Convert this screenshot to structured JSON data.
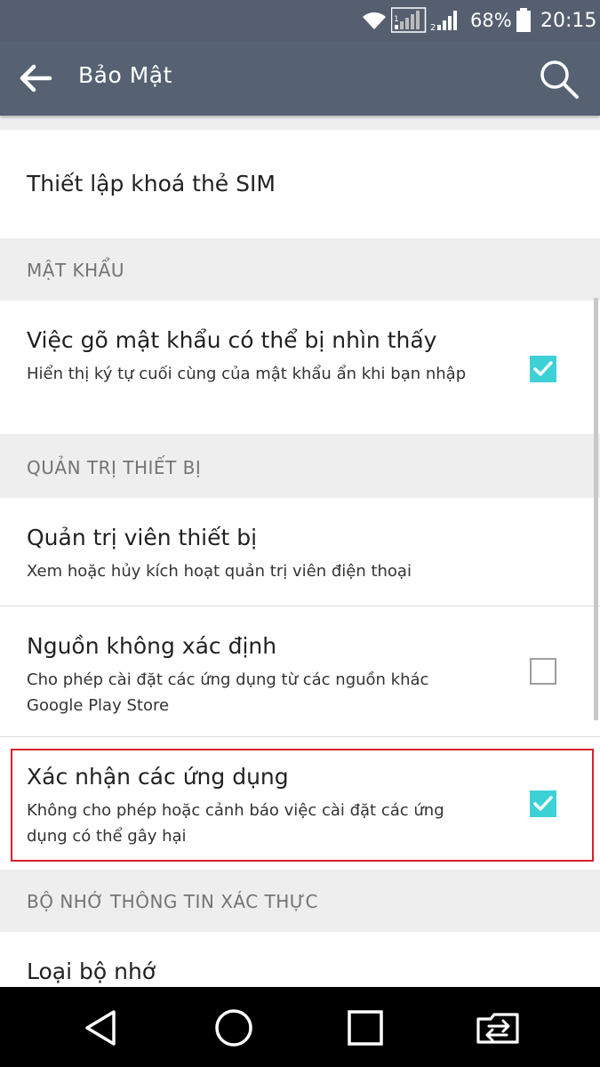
{
  "status_bar": {
    "battery_percent": "68%",
    "time": "20:15",
    "sim1_label": "1",
    "sim2_label": "2",
    "icons": [
      "wifi-icon",
      "sim1-signal-icon",
      "sim2-signal-icon",
      "battery-icon"
    ]
  },
  "app_bar": {
    "title": "Bảo Mật",
    "icons": [
      "back-arrow-icon",
      "search-icon"
    ]
  },
  "items": {
    "sim_lock": {
      "title": "Thiết lập khoá thẻ SIM"
    },
    "password_header": "MẬT KHẨU",
    "show_password": {
      "title": "Việc gõ mật khẩu có thể bị nhìn thấy",
      "subtitle": "Hiển thị ký tự cuối cùng của mật khẩu ẩn khi bạn nhập",
      "checked": true
    },
    "device_admin_header": "QUẢN TRỊ THIẾT BỊ",
    "device_admins": {
      "title": "Quản trị viên thiết bị",
      "subtitle": "Xem hoặc hủy kích hoạt quản trị viên điện thoại"
    },
    "unknown_sources": {
      "title": "Nguồn không xác định",
      "subtitle": "Cho phép cài đặt các ứng dụng từ các nguồn khác Google Play Store",
      "checked": false
    },
    "verify_apps": {
      "title": "Xác nhận các ứng dụng",
      "subtitle": "Không cho phép hoặc cảnh báo việc cài đặt các ứng dụng có thể gây hại",
      "checked": true
    },
    "credential_header": "BỘ NHỚ THÔNG TIN XÁC THỰC",
    "storage_type": {
      "title": "Loại bộ nhớ"
    }
  },
  "nav_bar": {
    "icons": [
      "back-triangle-icon",
      "home-circle-icon",
      "recents-square-icon",
      "dual-window-icon"
    ]
  },
  "colors": {
    "status_bar": "#555f6f",
    "app_bar": "#566272",
    "accent": "#3dd1d6",
    "section_bg": "#eeeeee",
    "highlight": "#d9202a"
  }
}
